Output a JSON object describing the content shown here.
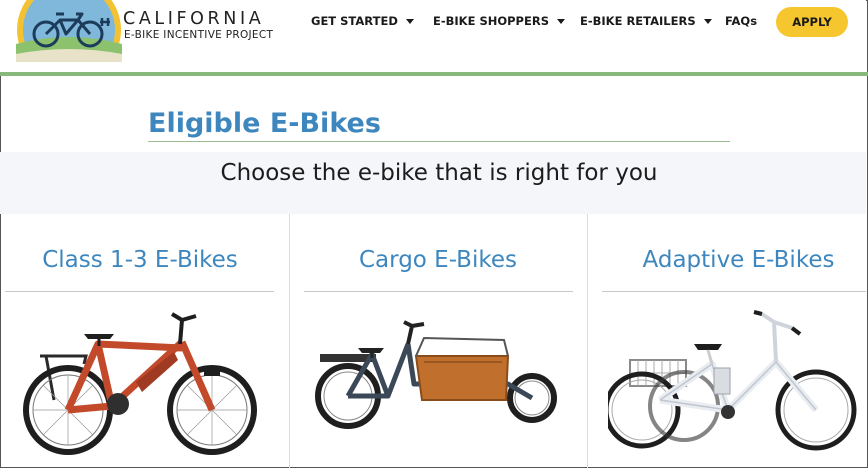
{
  "header": {
    "brand_title": "CALIFORNIA",
    "brand_subtitle": "E-BIKE INCENTIVE PROJECT",
    "nav": [
      {
        "label": "GET STARTED",
        "has_dropdown": true
      },
      {
        "label": "E-BIKE SHOPPERS",
        "has_dropdown": true
      },
      {
        "label": "E-BIKE RETAILERS",
        "has_dropdown": true
      },
      {
        "label": "FAQs",
        "has_dropdown": false
      }
    ],
    "apply_label": "APPLY"
  },
  "main": {
    "title": "Eligible E-Bikes",
    "tagline": "Choose the e-bike that is right for you",
    "categories": [
      {
        "title": "Class 1-3 E-Bikes",
        "icon": "orange-ebike-image"
      },
      {
        "title": "Cargo E-Bikes",
        "icon": "cargo-ebike-image"
      },
      {
        "title": "Adaptive E-Bikes",
        "icon": "adaptive-tricycle-image"
      }
    ]
  },
  "colors": {
    "accent_blue": "#3e87be",
    "header_green": "#86b97a",
    "apply_yellow": "#f5c62e",
    "tagline_band": "#f4f6fa"
  }
}
